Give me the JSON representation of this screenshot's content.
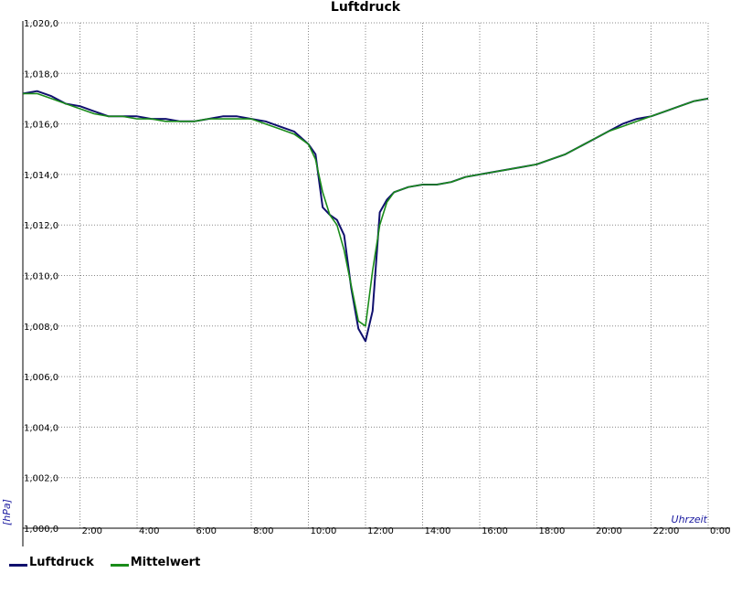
{
  "chart_data": {
    "type": "line",
    "title": "Luftdruck",
    "ylabel": "[hPa]",
    "xlabel": "Uhrzeit",
    "ylim": [
      1000.0,
      1020.0
    ],
    "xlim_hours": [
      0,
      24
    ],
    "y_ticks": [
      "1,000,0",
      "1,002,0",
      "1,004,0",
      "1,006,0",
      "1,008,0",
      "1,010,0",
      "1,012,0",
      "1,014,0",
      "1,016,0",
      "1,018,0",
      "1,020,0"
    ],
    "x_ticks": [
      "2:00",
      "4:00",
      "6:00",
      "8:00",
      "10:00",
      "12:00",
      "14:00",
      "16:00",
      "18:00",
      "20:00",
      "22:00",
      "0:00"
    ],
    "grid": true,
    "legend_placement": "bottom-left",
    "x_hours": [
      0,
      0.5,
      1,
      1.5,
      2,
      2.5,
      3,
      3.5,
      4,
      4.5,
      5,
      5.5,
      6,
      6.5,
      7,
      7.5,
      8,
      8.5,
      9,
      9.5,
      10,
      10.25,
      10.5,
      10.75,
      11,
      11.25,
      11.5,
      11.75,
      12,
      12.25,
      12.5,
      12.75,
      13,
      13.5,
      14,
      14.5,
      15,
      15.5,
      16,
      16.5,
      17,
      17.5,
      18,
      18.5,
      19,
      19.5,
      20,
      20.5,
      21,
      21.5,
      22,
      22.5,
      23,
      23.5,
      24
    ],
    "series": [
      {
        "name": "Luftdruck",
        "color": "#10106e",
        "values": [
          1017.2,
          1017.3,
          1017.1,
          1016.8,
          1016.7,
          1016.5,
          1016.3,
          1016.3,
          1016.3,
          1016.2,
          1016.2,
          1016.1,
          1016.1,
          1016.2,
          1016.3,
          1016.3,
          1016.2,
          1016.1,
          1015.9,
          1015.7,
          1015.2,
          1014.8,
          1012.7,
          1012.4,
          1012.2,
          1011.6,
          1009.5,
          1007.9,
          1007.4,
          1008.6,
          1012.5,
          1013.0,
          1013.3,
          1013.5,
          1013.6,
          1013.6,
          1013.7,
          1013.9,
          1014.0,
          1014.1,
          1014.2,
          1014.3,
          1014.4,
          1014.6,
          1014.8,
          1015.1,
          1015.4,
          1015.7,
          1016.0,
          1016.2,
          1016.3,
          1016.5,
          1016.7,
          1016.9,
          1017.0
        ]
      },
      {
        "name": "Mittelwert",
        "color": "#1a8c1a",
        "values": [
          1017.2,
          1017.2,
          1017.0,
          1016.8,
          1016.6,
          1016.4,
          1016.3,
          1016.3,
          1016.2,
          1016.2,
          1016.1,
          1016.1,
          1016.1,
          1016.2,
          1016.2,
          1016.2,
          1016.2,
          1016.0,
          1015.8,
          1015.6,
          1015.2,
          1014.6,
          1013.3,
          1012.4,
          1012.0,
          1011.0,
          1009.6,
          1008.2,
          1008.0,
          1010.2,
          1012.0,
          1012.9,
          1013.3,
          1013.5,
          1013.6,
          1013.6,
          1013.7,
          1013.9,
          1014.0,
          1014.1,
          1014.2,
          1014.3,
          1014.4,
          1014.6,
          1014.8,
          1015.1,
          1015.4,
          1015.7,
          1015.9,
          1016.1,
          1016.3,
          1016.5,
          1016.7,
          1016.9,
          1017.0
        ]
      }
    ]
  },
  "legend": {
    "items": [
      {
        "label": "Luftdruck",
        "color": "#10106e"
      },
      {
        "label": "Mittelwert",
        "color": "#1a8c1a"
      }
    ]
  }
}
